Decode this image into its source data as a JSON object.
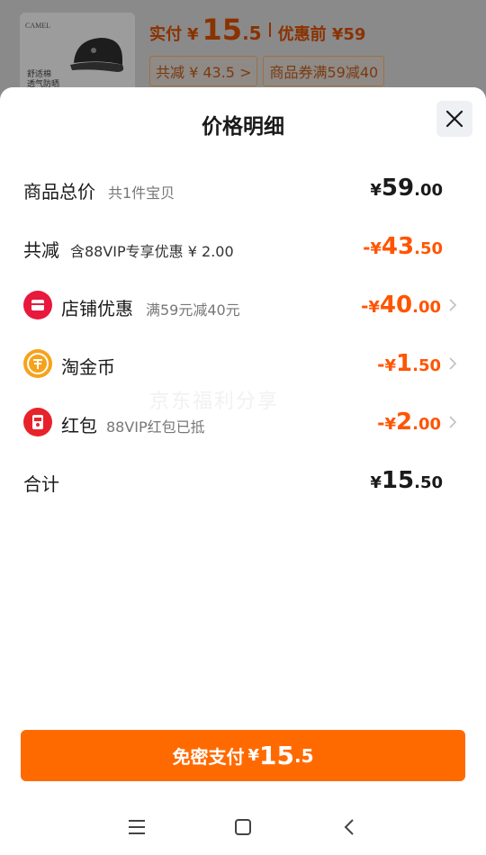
{
  "background": {
    "thumb_brand": "CAMEL",
    "thumb_tag_line1": "舒适棉",
    "thumb_tag_line2": "透气防晒",
    "price_label": "实付",
    "price_yen": "¥",
    "price_int": "15",
    "price_dec": ".5",
    "pre_label": "优惠前 ¥59",
    "chip_discount": "共减 ¥ 43.5 >",
    "chip_coupon": "商品券满59减40"
  },
  "sheet": {
    "title": "价格明细",
    "rows": [
      {
        "name": "商品总价",
        "sub": "共1件宝贝",
        "sign": "",
        "yen": "¥",
        "int": "59",
        "dec": ".00"
      },
      {
        "name": "共减",
        "sub": "含88VIP专享优惠 ¥ 2.00",
        "sign": "-",
        "yen": "¥",
        "int": "43",
        "dec": ".50"
      },
      {
        "name": "店铺优惠",
        "sub": "满59元减40元",
        "sign": "-",
        "yen": "¥",
        "int": "40",
        "dec": ".00"
      },
      {
        "name": "淘金币",
        "sub": "",
        "sign": "-",
        "yen": "¥",
        "int": "1",
        "dec": ".50"
      },
      {
        "name": "红包",
        "sub": "88VIP红包已抵",
        "sign": "-",
        "yen": "¥",
        "int": "2",
        "dec": ".00"
      },
      {
        "name": "合计",
        "sub": "",
        "sign": "",
        "yen": "¥",
        "int": "15",
        "dec": ".50"
      }
    ],
    "watermark": "京东福利分享",
    "pay_button": {
      "label": "免密支付",
      "yen": "¥",
      "int": "15",
      "dec": ".5"
    }
  },
  "colors": {
    "accent": "#ff6a00",
    "discount": "#ff5500",
    "shop_icon": "#e8193c",
    "coin_icon": "#f7a21b",
    "redpacket_icon": "#e8222a"
  },
  "icons": {
    "close": "close-icon",
    "shop": "shop-icon",
    "coin": "coin-icon",
    "redpacket": "red-packet-icon",
    "chevron": "chevron-right-icon"
  }
}
